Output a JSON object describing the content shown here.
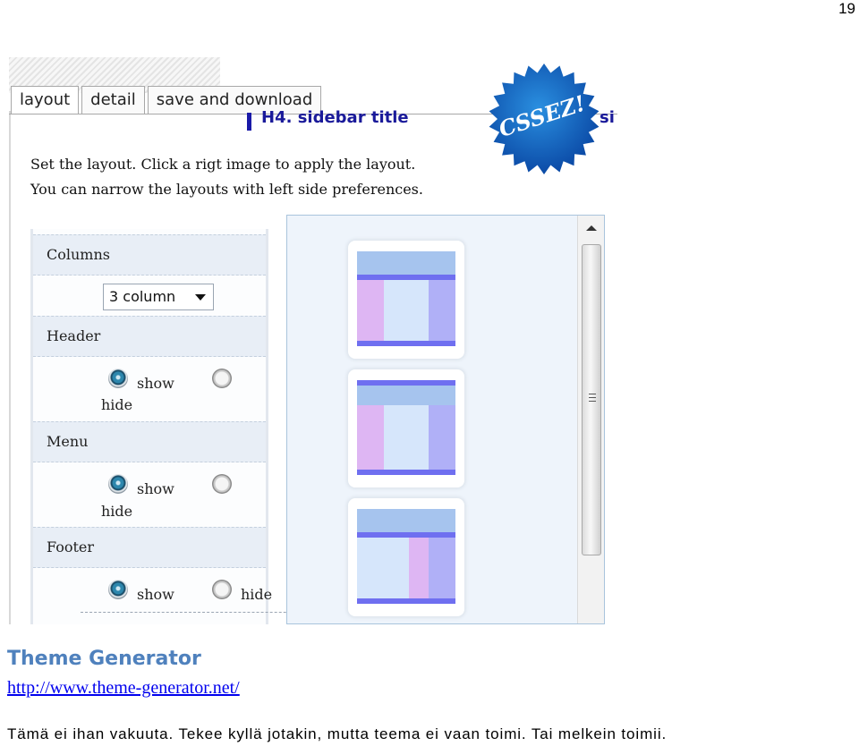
{
  "page_number": "19",
  "tabs": [
    {
      "label": "layout",
      "active": true
    },
    {
      "label": "detail",
      "active": false
    },
    {
      "label": "save and download",
      "active": false
    }
  ],
  "background_title": "H4. sidebar title",
  "background_title_2": "si",
  "badge_text": "CSSEZ!",
  "intro": {
    "line1": "Set the layout. Click a rigt image to apply the layout.",
    "line2": "You can narrow the layouts with left side preferences."
  },
  "prefs": {
    "columns": {
      "title": "Columns",
      "selected": "3 column"
    },
    "header": {
      "title": "Header",
      "show_label": "show",
      "hide_label": "hide",
      "value": "show"
    },
    "menu": {
      "title": "Menu",
      "show_label": "show",
      "hide_label": "hide",
      "value": "show"
    },
    "footer": {
      "title": "Footer",
      "show_label": "show",
      "hide_label": "hide",
      "value": "show"
    }
  },
  "colors": {
    "header_block": "#a6c4ee",
    "menu_bar": "#6f6ff0",
    "left_column": "#deb6f3",
    "center_column": "#d6e6fb",
    "right_column": "#b0b0f7",
    "caption_title": "#4f81bd"
  },
  "caption": {
    "title": "Theme Generator",
    "url": "http://www.theme-generator.net/",
    "body": "Tämä ei ihan vakuuta. Tekee kyllä jotakin, mutta teema ei vaan toimi. Tai melkein toimii."
  }
}
